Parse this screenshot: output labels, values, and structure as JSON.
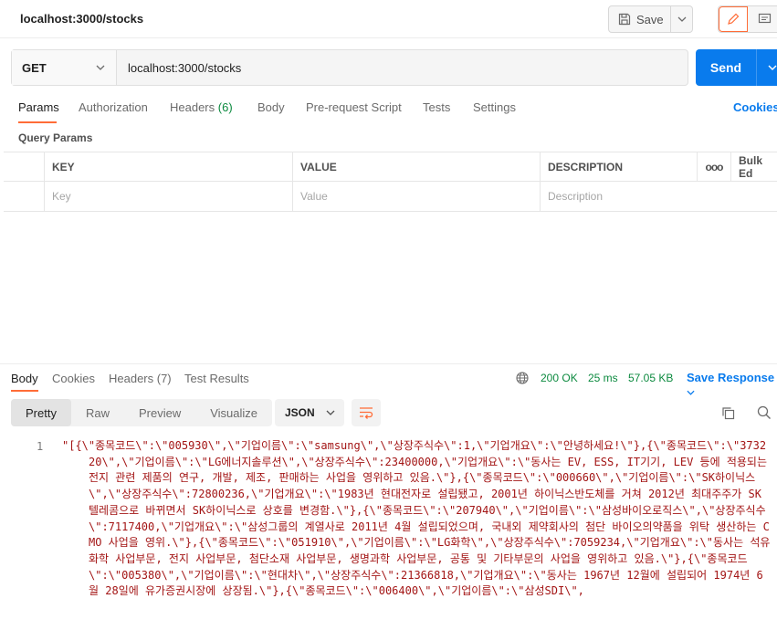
{
  "title_bar": {
    "request_name": "localhost:3000/stocks",
    "save_label": "Save"
  },
  "url_bar": {
    "method": "GET",
    "url": "localhost:3000/stocks",
    "send_label": "Send"
  },
  "request_tabs": {
    "params": "Params",
    "authorization": "Authorization",
    "headers": "Headers",
    "headers_count": "(6)",
    "body": "Body",
    "prerequest": "Pre-request Script",
    "tests": "Tests",
    "settings": "Settings",
    "cookies": "Cookies"
  },
  "query_params": {
    "title": "Query Params",
    "columns": {
      "key": "KEY",
      "value": "VALUE",
      "description": "DESCRIPTION",
      "more": "ooo",
      "bulk_edit": "Bulk Ed"
    },
    "placeholders": {
      "key": "Key",
      "value": "Value",
      "description": "Description"
    }
  },
  "response": {
    "tabs": {
      "body": "Body",
      "cookies": "Cookies",
      "headers": "Headers (7)",
      "test_results": "Test Results"
    },
    "status": "200 OK",
    "time": "25 ms",
    "size": "57.05 KB",
    "save_response": "Save Response",
    "views": {
      "pretty": "Pretty",
      "raw": "Raw",
      "preview": "Preview",
      "visualize": "Visualize"
    },
    "format": "JSON",
    "line_number": "1",
    "body_text": "\"[{\\\"종목코드\\\":\\\"005930\\\",\\\"기업이름\\\":\\\"samsung\\\",\\\"상장주식수\\\":1,\\\"기업개요\\\":\\\"안녕하세요!\\\"},{\\\"종목코드\\\":\\\"373220\\\",\\\"기업이름\\\":\\\"LG에너지솔루션\\\",\\\"상장주식수\\\":23400000,\\\"기업개요\\\":\\\"동사는 EV, ESS, IT기기, LEV 등에 적용되는 전지 관련 제품의 연구, 개발, 제조, 판매하는 사업을 영위하고 있음.\\\"},{\\\"종목코드\\\":\\\"000660\\\",\\\"기업이름\\\":\\\"SK하이닉스\\\",\\\"상장주식수\\\":72800236,\\\"기업개요\\\":\\\"1983년 현대전자로 설립됐고, 2001년 하이닉스반도체를 거쳐 2012년 최대주주가 SK텔레콤으로 바뀌면서 SK하이닉스로 상호를 변경함.\\\"},{\\\"종목코드\\\":\\\"207940\\\",\\\"기업이름\\\":\\\"삼성바이오로직스\\\",\\\"상장주식수\\\":7117400,\\\"기업개요\\\":\\\"삼성그룹의 계열사로 2011년 4월 설립되었으며, 국내외 제약회사의 첨단 바이오의약품을 위탁 생산하는 CMO 사업을 영위.\\\"},{\\\"종목코드\\\":\\\"051910\\\",\\\"기업이름\\\":\\\"LG화학\\\",\\\"상장주식수\\\":7059234,\\\"기업개요\\\":\\\"동사는 석유화학 사업부문, 전지 사업부문, 첨단소재 사업부문, 생명과학 사업부문, 공통 및 기타부문의 사업을 영위하고 있음.\\\"},{\\\"종목코드\\\":\\\"005380\\\",\\\"기업이름\\\":\\\"현대차\\\",\\\"상장주식수\\\":21366818,\\\"기업개요\\\":\\\"동사는 1967년 12월에 설립되어 1974년 6월 28일에 유가증권시장에 상장됨.\\\"},{\\\"종목코드\\\":\\\"006400\\\",\\\"기업이름\\\":\\\"삼성SDI\\\","
  }
}
